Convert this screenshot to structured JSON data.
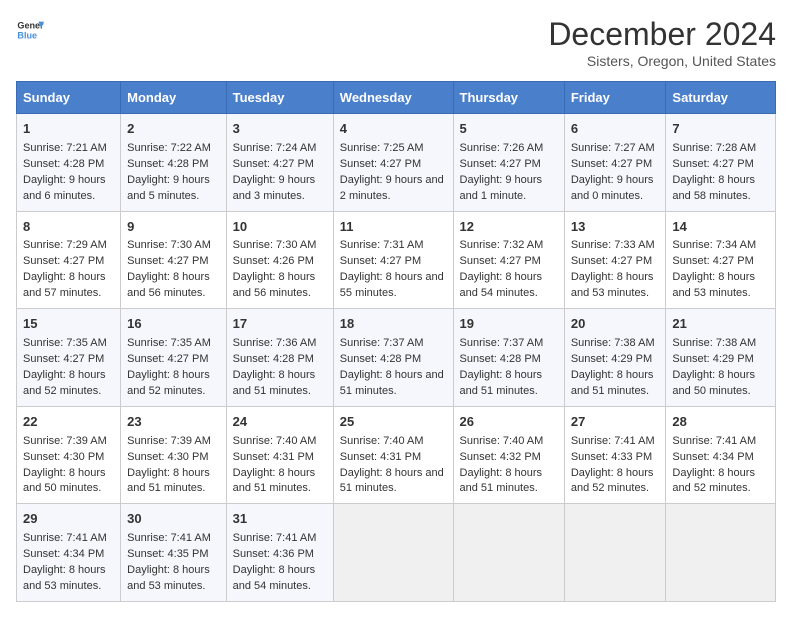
{
  "header": {
    "logo_line1": "General",
    "logo_line2": "Blue",
    "title": "December 2024",
    "subtitle": "Sisters, Oregon, United States"
  },
  "days_of_week": [
    "Sunday",
    "Monday",
    "Tuesday",
    "Wednesday",
    "Thursday",
    "Friday",
    "Saturday"
  ],
  "weeks": [
    [
      {
        "day": "1",
        "sunrise": "Sunrise: 7:21 AM",
        "sunset": "Sunset: 4:28 PM",
        "daylight": "Daylight: 9 hours and 6 minutes."
      },
      {
        "day": "2",
        "sunrise": "Sunrise: 7:22 AM",
        "sunset": "Sunset: 4:28 PM",
        "daylight": "Daylight: 9 hours and 5 minutes."
      },
      {
        "day": "3",
        "sunrise": "Sunrise: 7:24 AM",
        "sunset": "Sunset: 4:27 PM",
        "daylight": "Daylight: 9 hours and 3 minutes."
      },
      {
        "day": "4",
        "sunrise": "Sunrise: 7:25 AM",
        "sunset": "Sunset: 4:27 PM",
        "daylight": "Daylight: 9 hours and 2 minutes."
      },
      {
        "day": "5",
        "sunrise": "Sunrise: 7:26 AM",
        "sunset": "Sunset: 4:27 PM",
        "daylight": "Daylight: 9 hours and 1 minute."
      },
      {
        "day": "6",
        "sunrise": "Sunrise: 7:27 AM",
        "sunset": "Sunset: 4:27 PM",
        "daylight": "Daylight: 9 hours and 0 minutes."
      },
      {
        "day": "7",
        "sunrise": "Sunrise: 7:28 AM",
        "sunset": "Sunset: 4:27 PM",
        "daylight": "Daylight: 8 hours and 58 minutes."
      }
    ],
    [
      {
        "day": "8",
        "sunrise": "Sunrise: 7:29 AM",
        "sunset": "Sunset: 4:27 PM",
        "daylight": "Daylight: 8 hours and 57 minutes."
      },
      {
        "day": "9",
        "sunrise": "Sunrise: 7:30 AM",
        "sunset": "Sunset: 4:27 PM",
        "daylight": "Daylight: 8 hours and 56 minutes."
      },
      {
        "day": "10",
        "sunrise": "Sunrise: 7:30 AM",
        "sunset": "Sunset: 4:26 PM",
        "daylight": "Daylight: 8 hours and 56 minutes."
      },
      {
        "day": "11",
        "sunrise": "Sunrise: 7:31 AM",
        "sunset": "Sunset: 4:27 PM",
        "daylight": "Daylight: 8 hours and 55 minutes."
      },
      {
        "day": "12",
        "sunrise": "Sunrise: 7:32 AM",
        "sunset": "Sunset: 4:27 PM",
        "daylight": "Daylight: 8 hours and 54 minutes."
      },
      {
        "day": "13",
        "sunrise": "Sunrise: 7:33 AM",
        "sunset": "Sunset: 4:27 PM",
        "daylight": "Daylight: 8 hours and 53 minutes."
      },
      {
        "day": "14",
        "sunrise": "Sunrise: 7:34 AM",
        "sunset": "Sunset: 4:27 PM",
        "daylight": "Daylight: 8 hours and 53 minutes."
      }
    ],
    [
      {
        "day": "15",
        "sunrise": "Sunrise: 7:35 AM",
        "sunset": "Sunset: 4:27 PM",
        "daylight": "Daylight: 8 hours and 52 minutes."
      },
      {
        "day": "16",
        "sunrise": "Sunrise: 7:35 AM",
        "sunset": "Sunset: 4:27 PM",
        "daylight": "Daylight: 8 hours and 52 minutes."
      },
      {
        "day": "17",
        "sunrise": "Sunrise: 7:36 AM",
        "sunset": "Sunset: 4:28 PM",
        "daylight": "Daylight: 8 hours and 51 minutes."
      },
      {
        "day": "18",
        "sunrise": "Sunrise: 7:37 AM",
        "sunset": "Sunset: 4:28 PM",
        "daylight": "Daylight: 8 hours and 51 minutes."
      },
      {
        "day": "19",
        "sunrise": "Sunrise: 7:37 AM",
        "sunset": "Sunset: 4:28 PM",
        "daylight": "Daylight: 8 hours and 51 minutes."
      },
      {
        "day": "20",
        "sunrise": "Sunrise: 7:38 AM",
        "sunset": "Sunset: 4:29 PM",
        "daylight": "Daylight: 8 hours and 51 minutes."
      },
      {
        "day": "21",
        "sunrise": "Sunrise: 7:38 AM",
        "sunset": "Sunset: 4:29 PM",
        "daylight": "Daylight: 8 hours and 50 minutes."
      }
    ],
    [
      {
        "day": "22",
        "sunrise": "Sunrise: 7:39 AM",
        "sunset": "Sunset: 4:30 PM",
        "daylight": "Daylight: 8 hours and 50 minutes."
      },
      {
        "day": "23",
        "sunrise": "Sunrise: 7:39 AM",
        "sunset": "Sunset: 4:30 PM",
        "daylight": "Daylight: 8 hours and 51 minutes."
      },
      {
        "day": "24",
        "sunrise": "Sunrise: 7:40 AM",
        "sunset": "Sunset: 4:31 PM",
        "daylight": "Daylight: 8 hours and 51 minutes."
      },
      {
        "day": "25",
        "sunrise": "Sunrise: 7:40 AM",
        "sunset": "Sunset: 4:31 PM",
        "daylight": "Daylight: 8 hours and 51 minutes."
      },
      {
        "day": "26",
        "sunrise": "Sunrise: 7:40 AM",
        "sunset": "Sunset: 4:32 PM",
        "daylight": "Daylight: 8 hours and 51 minutes."
      },
      {
        "day": "27",
        "sunrise": "Sunrise: 7:41 AM",
        "sunset": "Sunset: 4:33 PM",
        "daylight": "Daylight: 8 hours and 52 minutes."
      },
      {
        "day": "28",
        "sunrise": "Sunrise: 7:41 AM",
        "sunset": "Sunset: 4:34 PM",
        "daylight": "Daylight: 8 hours and 52 minutes."
      }
    ],
    [
      {
        "day": "29",
        "sunrise": "Sunrise: 7:41 AM",
        "sunset": "Sunset: 4:34 PM",
        "daylight": "Daylight: 8 hours and 53 minutes."
      },
      {
        "day": "30",
        "sunrise": "Sunrise: 7:41 AM",
        "sunset": "Sunset: 4:35 PM",
        "daylight": "Daylight: 8 hours and 53 minutes."
      },
      {
        "day": "31",
        "sunrise": "Sunrise: 7:41 AM",
        "sunset": "Sunset: 4:36 PM",
        "daylight": "Daylight: 8 hours and 54 minutes."
      },
      null,
      null,
      null,
      null
    ]
  ]
}
